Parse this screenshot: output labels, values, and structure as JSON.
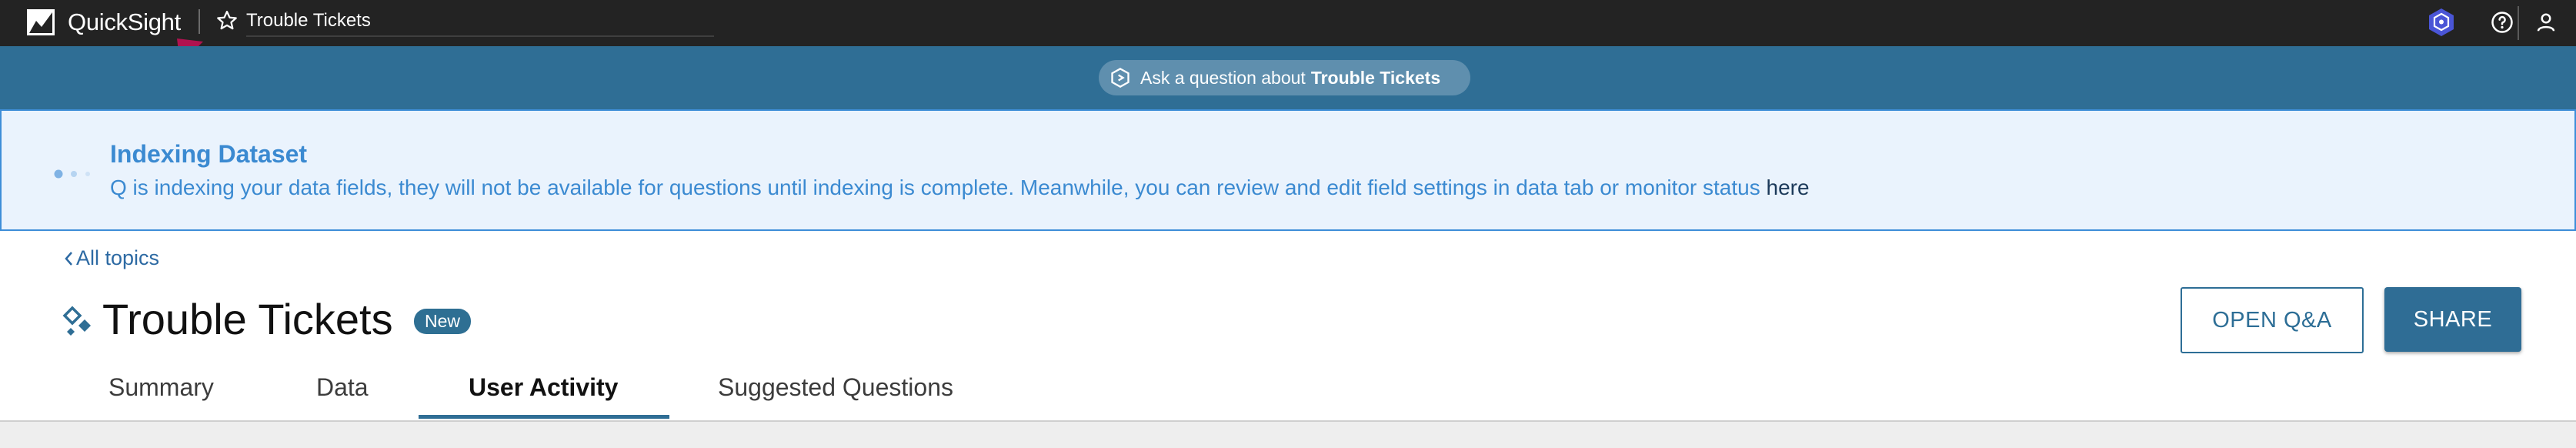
{
  "topbar": {
    "brand": "QuickSight",
    "document_title": "Trouble Tickets",
    "icons": [
      "quicksight-logo-icon",
      "star-icon",
      "q-badge-icon",
      "help-icon",
      "user-icon"
    ]
  },
  "ask_bar": {
    "prefix": "Ask a question about",
    "topic": "Trouble Tickets",
    "icon": "q-hexagon-icon"
  },
  "banner": {
    "title": "Indexing Dataset",
    "text": "Q is indexing your data fields, they will not be available for questions until indexing is complete. Meanwhile, you can review and edit field settings in data tab or monitor status ",
    "link_text": "here"
  },
  "header": {
    "back_label": "All topics",
    "title": "Trouble Tickets",
    "badge": "New",
    "open_qa_label": "OPEN Q&A",
    "share_label": "SHARE"
  },
  "tabs": [
    {
      "label": "Summary"
    },
    {
      "label": "Data"
    },
    {
      "label": "User Activity",
      "active": true
    },
    {
      "label": "Suggested Questions"
    }
  ],
  "colors": {
    "topbar": "#232323",
    "band": "#2f6e95",
    "banner_bg": "#eaf3fd",
    "banner_text": "#3b8ad1",
    "accent": "#2f6e95",
    "arrow": "#b0124f"
  }
}
